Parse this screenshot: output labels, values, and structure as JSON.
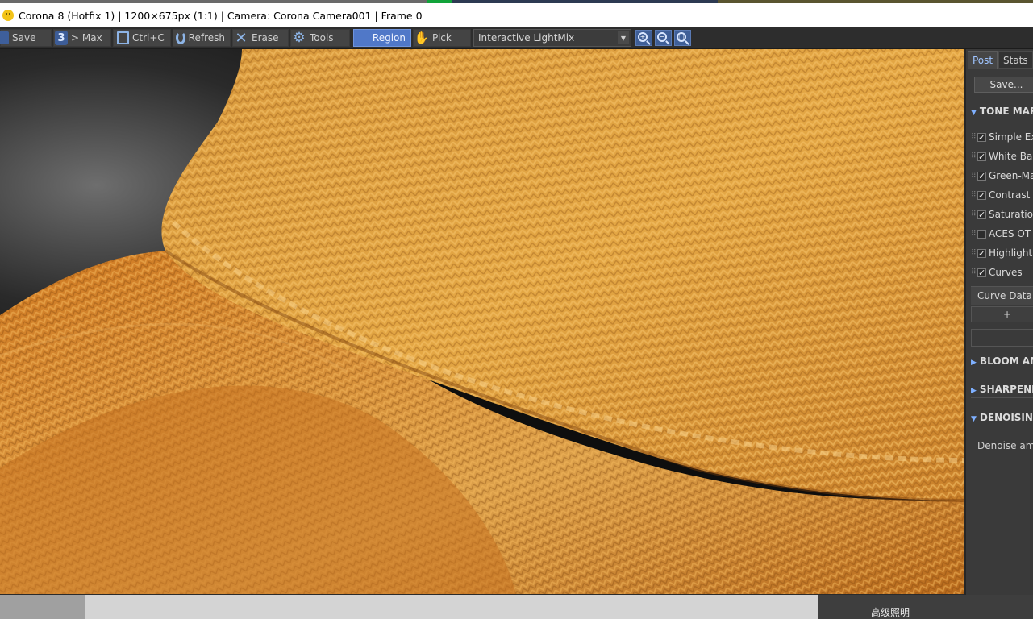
{
  "title_bar": {
    "text": "Corona 8 (Hotfix 1) | 1200×675px (1:1) | Camera: Corona Camera001 | Frame 0",
    "icon": "smiley-icon"
  },
  "toolbar": {
    "save_label": "Save",
    "max_label": "> Max",
    "copy_label": "Ctrl+C",
    "refresh_label": "Refresh",
    "erase_label": "Erase",
    "tools_label": "Tools",
    "region_label": "Region",
    "pick_label": "Pick",
    "mode_select_value": "Interactive LightMix",
    "zoom_in": "+",
    "zoom_out": "−",
    "zoom_fit": "□",
    "icons": [
      "floppy-icon",
      "3dsmax-icon",
      "copy-icon",
      "refresh-icon",
      "erase-icon",
      "gear-icon",
      "region-icon",
      "hand-icon",
      "zoom-in-icon",
      "zoom-out-icon",
      "zoom-fit-icon"
    ]
  },
  "panel": {
    "tabs": [
      {
        "label": "Post",
        "active": true
      },
      {
        "label": "Stats",
        "active": false
      }
    ],
    "save_button": "Save...",
    "sections": {
      "tone_mapping": "TONE MAP",
      "bloom": "BLOOM AN",
      "sharpening": "SHARPENI",
      "denoising": "DENOISING"
    },
    "operators": [
      {
        "label": "Simple Ex",
        "checked": true
      },
      {
        "label": "White Bal",
        "checked": true
      },
      {
        "label": "Green-Ma",
        "checked": true
      },
      {
        "label": "Contrast",
        "checked": true
      },
      {
        "label": "Saturation",
        "checked": true
      },
      {
        "label": "ACES OT",
        "checked": false
      },
      {
        "label": "Highlight",
        "checked": true
      },
      {
        "label": "Curves",
        "checked": true
      }
    ],
    "curve_data_label": "Curve Data",
    "add_label": "+",
    "denoise_label": "Denoise am"
  },
  "bottom_strip": {
    "label": "高级照明"
  },
  "colors": {
    "accent": "#5078c8",
    "panel_bg": "#3a3a3a",
    "toolbar_bg": "#2d2d2d",
    "render_orange": "#d8922c"
  }
}
